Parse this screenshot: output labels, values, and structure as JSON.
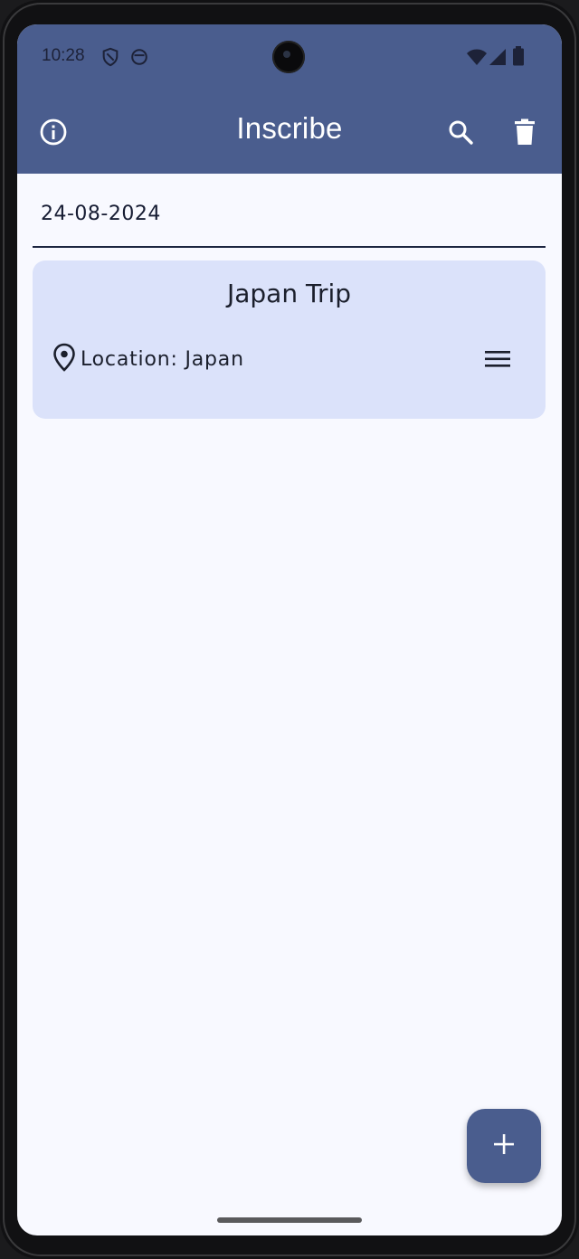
{
  "status_bar": {
    "time": "10:28",
    "icons": [
      "shield-icon",
      "face-icon",
      "wifi-icon",
      "signal-icon",
      "battery-icon"
    ]
  },
  "app_bar": {
    "title": "Inscribe",
    "icons": [
      "info-icon",
      "search-icon",
      "delete-icon"
    ],
    "color": "#4a5d8e"
  },
  "date_filter": {
    "value": "24-08-2024"
  },
  "entries": [
    {
      "title": "Japan Trip",
      "location_label": "Location: Japan",
      "icons": [
        "location-pin-icon",
        "menu-icon"
      ]
    }
  ],
  "fab": {
    "icon": "plus-icon"
  },
  "colors": {
    "accent": "#4a5d8e",
    "card_background": "#dbe2fa",
    "page_background": "#f8f9ff"
  }
}
